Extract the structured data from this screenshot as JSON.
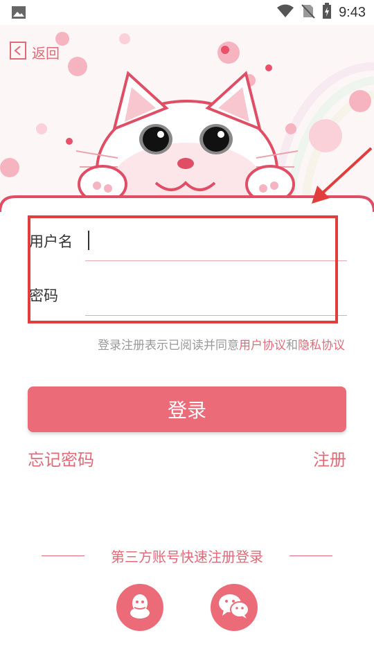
{
  "status_bar": {
    "time": "9:43"
  },
  "header": {
    "back_label": "返回"
  },
  "form": {
    "username_label": "用户名",
    "password_label": "密码"
  },
  "agreement": {
    "prefix": "登录注册表示已阅读并同意",
    "user_agreement": "用户协议",
    "conjunction": "和",
    "privacy_policy": "隐私协议"
  },
  "actions": {
    "login_label": "登录",
    "forgot_password_label": "忘记密码",
    "register_label": "注册"
  },
  "third_party": {
    "title": "第三方账号快速注册登录",
    "providers": [
      "qq-icon",
      "wechat-icon"
    ]
  },
  "colors": {
    "accent": "#ec6b78",
    "highlight": "#e13d3d"
  }
}
